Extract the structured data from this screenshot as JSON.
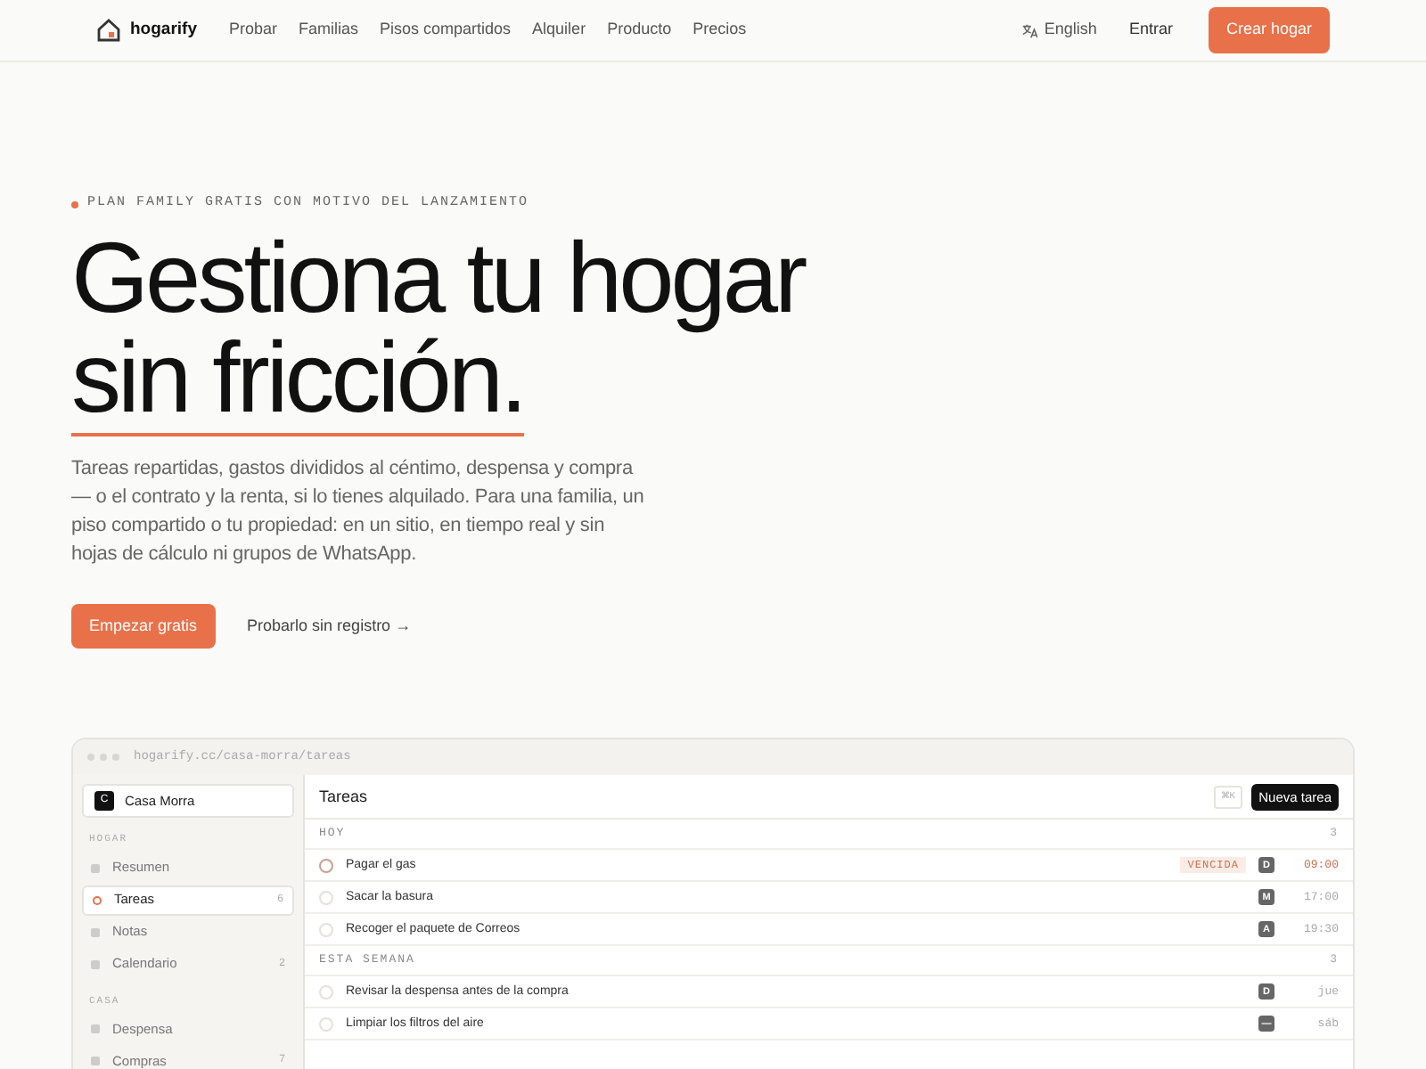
{
  "nav": {
    "brand": "hogarify",
    "links": [
      "Probar",
      "Familias",
      "Pisos compartidos",
      "Alquiler",
      "Producto",
      "Precios"
    ],
    "language": "English",
    "login": "Entrar",
    "cta": "Crear hogar"
  },
  "hero": {
    "badge": "PLAN FAMILY GRATIS CON MOTIVO DEL LANZAMIENTO",
    "title_line_1": "Gestiona tu hogar",
    "title_line_2": "sin fricción.",
    "text": "Tareas repartidas, gastos divididos al céntimo, despensa y compra — o el contrato y la renta, si lo tienes alquilado. Para una familia, un piso compartido o tu propiedad: en un sitio, en tiempo real y sin hojas de cálculo ni grupos de WhatsApp.",
    "primary_button": "Empezar gratis",
    "secondary_link": "Probarlo sin registro →"
  },
  "app": {
    "url": "hogarify.cc/casa-morra/tareas",
    "home": {
      "initial": "C",
      "name": "Casa Morra"
    },
    "sidebar": [
      {
        "heading": "HOGAR",
        "items": [
          {
            "label": "Resumen",
            "selected": false
          },
          {
            "label": "Tareas",
            "count": "6",
            "selected": true
          },
          {
            "label": "Notas",
            "selected": false
          },
          {
            "label": "Calendario",
            "count": "2",
            "selected": false
          }
        ]
      },
      {
        "heading": "CASA",
        "items": [
          {
            "label": "Despensa",
            "selected": false
          },
          {
            "label": "Compras",
            "count": "7",
            "selected": false
          }
        ]
      }
    ],
    "title": "Tareas",
    "shortcut": "⌘K",
    "new_button": "Nueva tarea",
    "groups": [
      {
        "heading": "HOY",
        "count": "3",
        "tasks": [
          {
            "label": "Pagar el gas",
            "checked": false,
            "overdue": true,
            "tag": "VENCIDA",
            "assignee": "D",
            "due": "09:00"
          },
          {
            "label": "Sacar la basura",
            "checked": false,
            "overdue": false,
            "assignee": "M",
            "due": "17:00"
          },
          {
            "label": "Recoger el paquete de Correos",
            "checked": false,
            "overdue": false,
            "assignee": "A",
            "due": "19:30"
          }
        ]
      },
      {
        "heading": "ESTA SEMANA",
        "count": "3",
        "tasks": [
          {
            "label": "Revisar la despensa antes de la compra",
            "checked": false,
            "overdue": false,
            "assignee": "D",
            "due": "jue"
          },
          {
            "label": "Limpiar los filtros del aire",
            "checked": false,
            "overdue": false,
            "assignee": "—",
            "due": "sáb"
          }
        ]
      }
    ]
  }
}
